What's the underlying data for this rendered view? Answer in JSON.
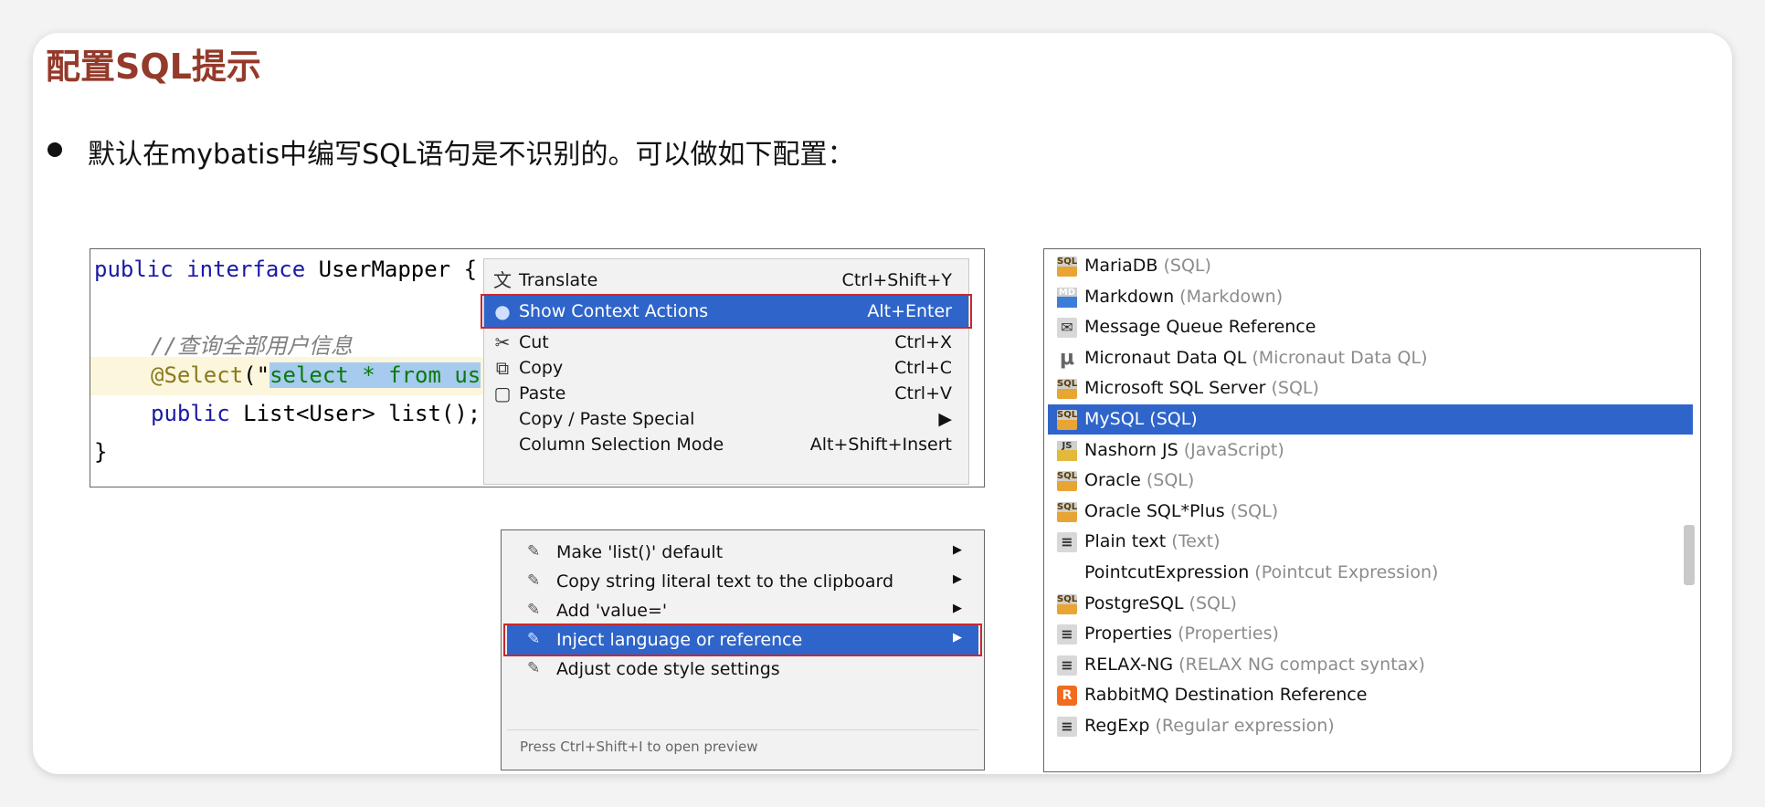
{
  "slide": {
    "title": "配置SQL提示",
    "bullet": "默认在mybatis中编写SQL语句是不识别的。可以做如下配置："
  },
  "code": {
    "line1_kw": "public interface ",
    "line1_rest": "UserMapper {",
    "comment": "//查询全部用户信息",
    "annot": "@Select",
    "annot_open": "(\"",
    "sql_sel": "select * from us",
    "line4_kw": "public ",
    "line4_rest": "List<User> list();",
    "close": "}"
  },
  "context_menu": [
    {
      "icon": "translate-icon",
      "glyph": "文",
      "label": "Translate",
      "shortcut": "Ctrl+Shift+Y"
    },
    {
      "icon": "lightbulb-icon",
      "glyph": "●",
      "label": "Show Context Actions",
      "shortcut": "Alt+Enter"
    },
    {
      "icon": "scissors-icon",
      "glyph": "✂",
      "label": "Cut",
      "shortcut": "Ctrl+X"
    },
    {
      "icon": "copy-icon",
      "glyph": "⧉",
      "label": "Copy",
      "shortcut": "Ctrl+C"
    },
    {
      "icon": "paste-icon",
      "glyph": "▢",
      "label": "Paste",
      "shortcut": "Ctrl+V"
    },
    {
      "icon": "",
      "glyph": "",
      "label": "Copy / Paste Special",
      "shortcut": "▶"
    },
    {
      "icon": "",
      "glyph": "",
      "label": "Column Selection Mode",
      "shortcut": "Alt+Shift+Insert"
    }
  ],
  "intent_menu": {
    "items": [
      {
        "label": "Make 'list()' default",
        "arrow": "▶"
      },
      {
        "label": "Copy string literal text to the clipboard",
        "arrow": "▶"
      },
      {
        "label": "Add 'value='",
        "arrow": "▶"
      },
      {
        "label": "Inject language or reference",
        "arrow": "▶"
      },
      {
        "label": "Adjust code style settings",
        "arrow": ""
      }
    ],
    "hint": "Press Ctrl+Shift+I to open preview"
  },
  "languages": [
    {
      "name": "MariaDB",
      "type": "(SQL)",
      "icon": "sql-icon",
      "glyph": "SQL"
    },
    {
      "name": "Markdown",
      "type": "(Markdown)",
      "icon": "markdown-icon",
      "glyph": "MD"
    },
    {
      "name": "Message Queue Reference",
      "type": "",
      "icon": "message-queue-icon",
      "glyph": "✉"
    },
    {
      "name": "Micronaut Data QL",
      "type": "(Micronaut Data QL)",
      "icon": "micronaut-icon",
      "glyph": "μ"
    },
    {
      "name": "Microsoft SQL Server",
      "type": "(SQL)",
      "icon": "sql-icon",
      "glyph": "SQL"
    },
    {
      "name": "MySQL",
      "type": "(SQL)",
      "icon": "sql-icon",
      "glyph": "SQL"
    },
    {
      "name": "Nashorn JS",
      "type": "(JavaScript)",
      "icon": "javascript-icon",
      "glyph": "JS"
    },
    {
      "name": "Oracle",
      "type": "(SQL)",
      "icon": "sql-icon",
      "glyph": "SQL"
    },
    {
      "name": "Oracle SQL*Plus",
      "type": "(SQL)",
      "icon": "sql-icon",
      "glyph": "SQL"
    },
    {
      "name": "Plain text",
      "type": "(Text)",
      "icon": "text-file-icon",
      "glyph": "≡"
    },
    {
      "name": "PointcutExpression",
      "type": "(Pointcut Expression)",
      "icon": "",
      "glyph": ""
    },
    {
      "name": "PostgreSQL",
      "type": "(SQL)",
      "icon": "sql-icon",
      "glyph": "SQL"
    },
    {
      "name": "Properties",
      "type": "(Properties)",
      "icon": "properties-icon",
      "glyph": "≡"
    },
    {
      "name": "RELAX-NG",
      "type": "(RELAX NG compact syntax)",
      "icon": "relax-ng-icon",
      "glyph": "≡"
    },
    {
      "name": "RabbitMQ Destination Reference",
      "type": "",
      "icon": "rabbitmq-icon",
      "glyph": "R"
    },
    {
      "name": "RegExp",
      "type": "(Regular expression)",
      "icon": "regexp-icon",
      "glyph": "≡"
    }
  ]
}
